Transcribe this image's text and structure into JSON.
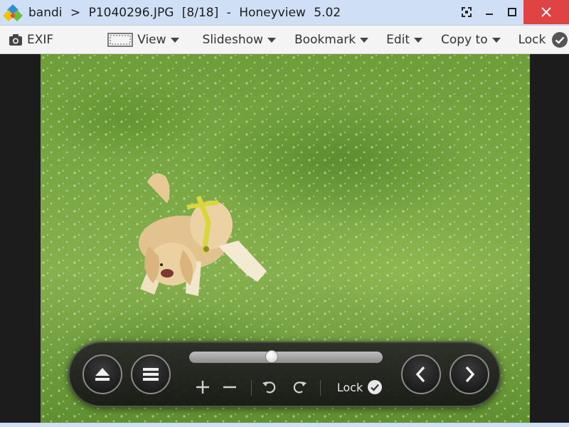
{
  "titlebar": {
    "segments": [
      "bandi",
      ">",
      "P1040296.JPG",
      "[8/18]",
      "-",
      "Honeyview",
      "5.02"
    ]
  },
  "menubar": {
    "exif": "EXIF",
    "view": "View",
    "slideshow": "Slideshow",
    "bookmark": "Bookmark",
    "edit": "Edit",
    "copy_to": "Copy to",
    "lock": "Lock"
  },
  "controls": {
    "lock_label": "Lock",
    "slider_position": 0.42
  },
  "colors": {
    "titlebar_bg": "#cfe0f6",
    "close_button": "#e04343",
    "menubar_bg": "#f4f4f4"
  }
}
